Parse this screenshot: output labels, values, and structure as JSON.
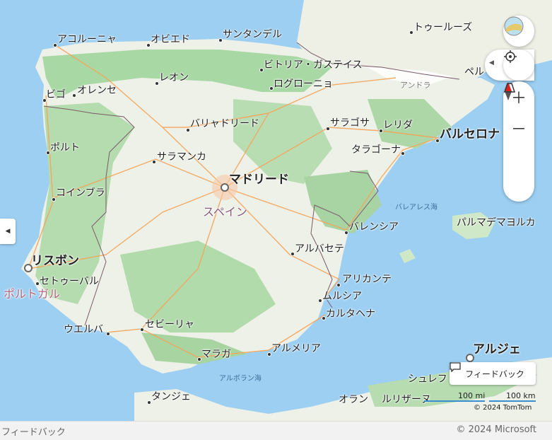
{
  "cities": {
    "a_coruna": "アコルーニャ",
    "oviedo": "オビエド",
    "santander": "サンタンデル",
    "toulouse": "トゥールーズ",
    "vitoria": "ビトリア・ガステイス",
    "leon": "レオン",
    "logrono": "ログローニョ",
    "vigo": "ビゴ",
    "ourense": "オレンセ",
    "valladolid": "バリャドリード",
    "zaragoza": "サラゴサ",
    "lleida": "レリダ",
    "barcelona": "バルセロナ",
    "porto": "ポルト",
    "salamanca": "サラマンカ",
    "tarragona": "タラゴーナ",
    "madrid": "マドリード",
    "coimbra": "コインブラ",
    "valencia": "バレンシア",
    "palma": "パルマデマヨルカ",
    "albacete": "アルバセテ",
    "lisbon": "リスボン",
    "setubal": "セトゥーバル",
    "alicante": "アリカンテ",
    "murcia": "ムルシア",
    "cartagena": "カルタヘナ",
    "huelva": "ウエルバ",
    "sevilla": "セビーリャ",
    "malaga": "マラガ",
    "almeria": "アルメリア",
    "algiers": "アルジェ",
    "tangier": "タンジェ",
    "oran": "オラン",
    "perpignan_partial": "ペル",
    "lrizane_partial": "ルリザーヌ",
    "chlef_partial": "シュレフ"
  },
  "regions": {
    "spain": "スペイン",
    "portugal": "ポルトガル",
    "balearic_sea": "バレアレス海",
    "alboran_sea": "アルボラン海",
    "andorra": "アンドラ"
  },
  "controls": {
    "feedback_label": "フィードバック",
    "scale_mi": "100 mi",
    "scale_km": "100 km",
    "tomtom": "© 2024 TomTom"
  },
  "footer": {
    "feedback": "フィードバック",
    "copyright": "© 2024 Microsoft"
  },
  "colors": {
    "sea": "#9ccff2",
    "land": "#f3efe4",
    "vegetation": "#a8d8a4",
    "road": "#f5a45a"
  }
}
